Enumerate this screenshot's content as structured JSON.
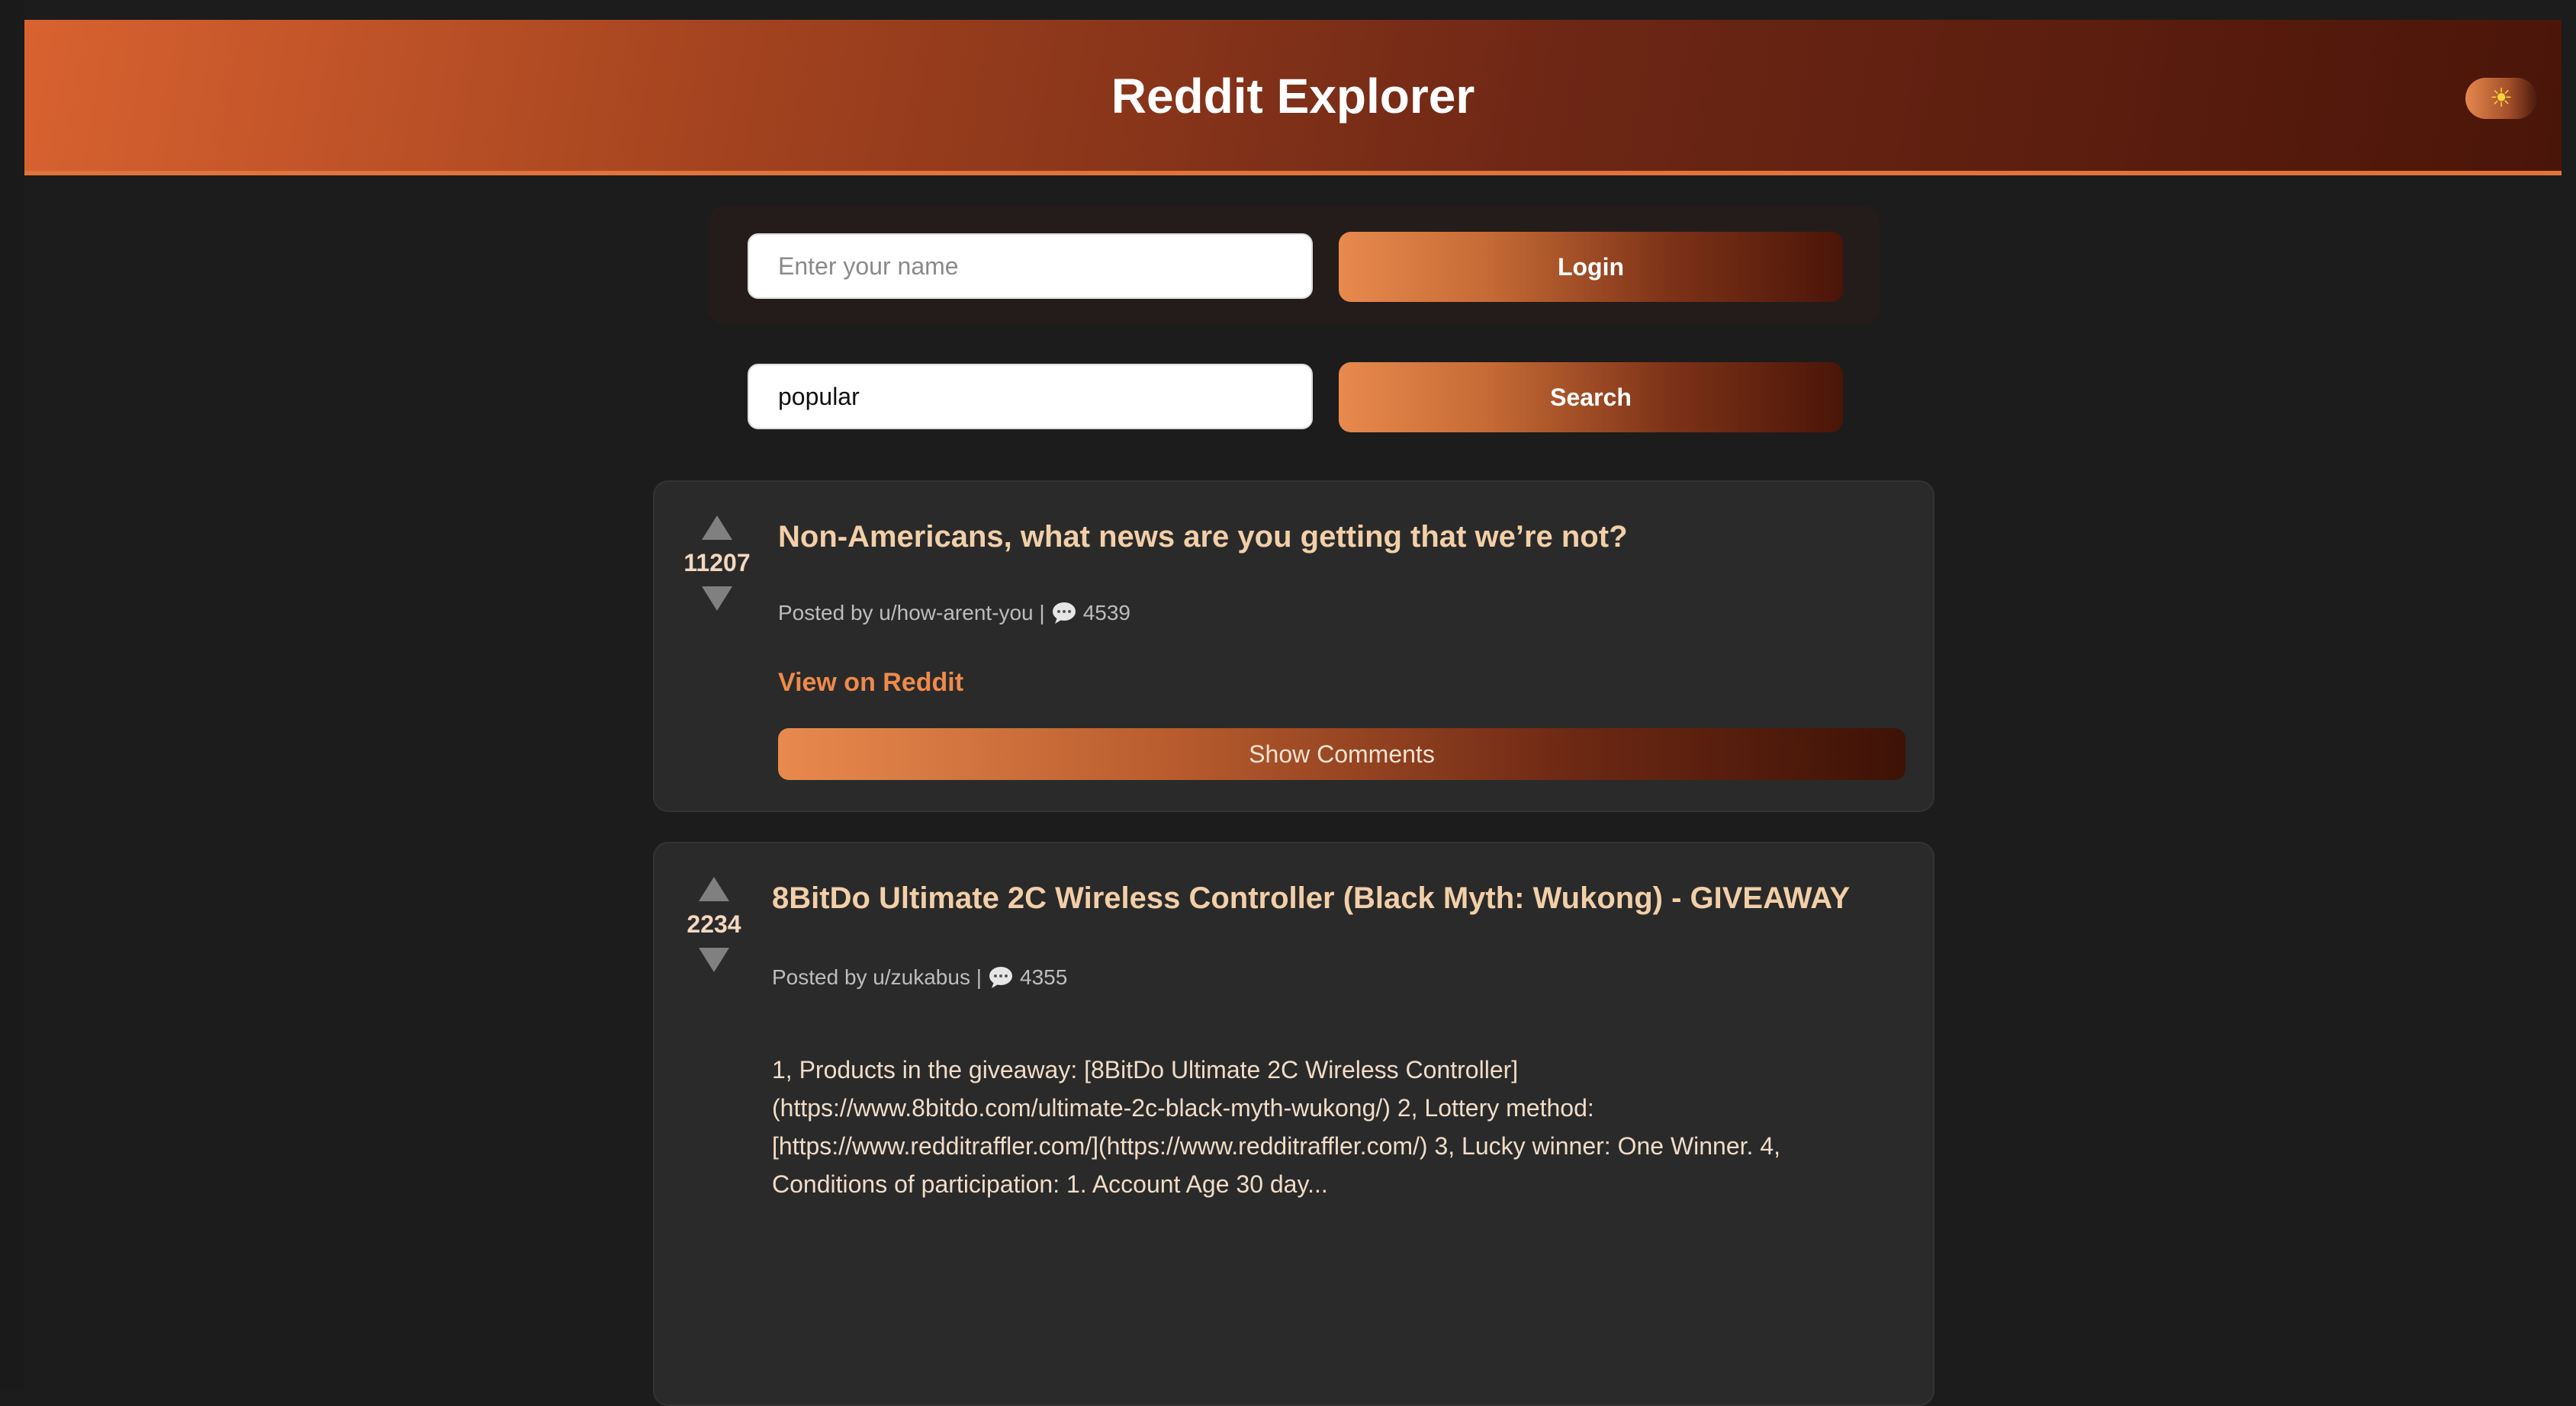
{
  "header": {
    "title": "Reddit Explorer",
    "theme_icon": "☀"
  },
  "login": {
    "name_placeholder": "Enter your name",
    "name_value": "",
    "login_label": "Login"
  },
  "search": {
    "value": "popular",
    "button_label": "Search"
  },
  "posts": [
    {
      "score": "11207",
      "title": "Non-Americans, what news are you getting that we’re not?",
      "posted_by": "Posted by u/how-arent-you |",
      "comments": "4539",
      "view_link": "View on Reddit",
      "show_comments_label": "Show Comments"
    },
    {
      "score": "2234",
      "title": "8BitDo Ultimate 2C Wireless Controller (Black Myth: Wukong) - GIVEAWAY",
      "posted_by": "Posted by u/zukabus |",
      "comments": "4355",
      "body_lines": [
        "1, Products in the giveaway: [8BitDo Ultimate 2C Wireless Controller]",
        "(https://www.8bitdo.com/ultimate-2c-black-myth-wukong/) 2, Lottery method:",
        "[https://www.redditraffler.com/](https://www.redditraffler.com/) 3, Lucky winner: One Winner. 4,",
        "Conditions of participation: 1. Account Age 30 day..."
      ]
    }
  ],
  "colors": {
    "accent": "#ef8a4c",
    "header_start": "#d96230",
    "header_end": "#4a1509",
    "card_bg": "#2a2a2a",
    "page_bg": "#1c1c1c",
    "title_text": "#f2cfa8"
  }
}
